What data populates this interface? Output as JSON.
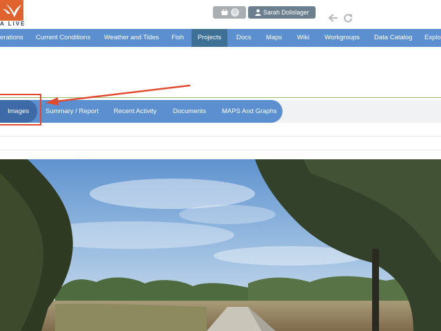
{
  "header": {
    "logo_text": "A LIVE",
    "cart_count": "0",
    "user_name": "Sarah Dolislager",
    "icons": [
      "basket-icon",
      "user-icon",
      "back-arrow-icon",
      "refresh-icon"
    ]
  },
  "nav": {
    "items": [
      {
        "label": "erations",
        "active": false
      },
      {
        "label": "Current Conditions",
        "active": false
      },
      {
        "label": "Weather and Tides",
        "active": false
      },
      {
        "label": "Fish",
        "active": false
      },
      {
        "label": "Projects",
        "active": true
      },
      {
        "label": "Docs",
        "active": false
      },
      {
        "label": "Maps",
        "active": false
      },
      {
        "label": "Wiki",
        "active": false
      },
      {
        "label": "Workgroups",
        "active": false
      },
      {
        "label": "Data Catalog",
        "active": false
      },
      {
        "label": "Explor",
        "active": false
      }
    ]
  },
  "subnav": {
    "tabs": [
      {
        "label": "Images",
        "active": true
      },
      {
        "label": "Summary / Report",
        "active": false
      },
      {
        "label": "Recent Activity",
        "active": false
      },
      {
        "label": "Documents",
        "active": false
      },
      {
        "label": "MAPS And Graphs",
        "active": false
      }
    ]
  },
  "colors": {
    "nav_blue": "#5b8fd0",
    "nav_active": "#3e7096",
    "annotation_red": "#e24a30",
    "logo_orange": "#e0632f"
  }
}
